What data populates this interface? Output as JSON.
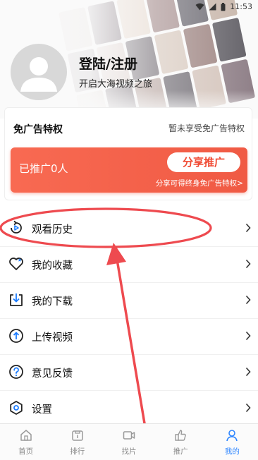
{
  "status_bar": {
    "time": "11:53"
  },
  "colors": {
    "accent": "#2f86ff",
    "promo": "#f05a44",
    "annotation": "#ee4a4f"
  },
  "profile": {
    "title": "登陆/注册",
    "subtitle": "开启大海视频之旅"
  },
  "vip": {
    "title": "免广告特权",
    "status": "暂未享受免广告特权",
    "promo_count": "已推广0人",
    "share_button": "分享推广",
    "share_note": "分享可得终身免广告特权>"
  },
  "menu": [
    {
      "label": "观看历史",
      "icon": "history-icon"
    },
    {
      "label": "我的收藏",
      "icon": "heart-icon"
    },
    {
      "label": "我的下载",
      "icon": "download-icon"
    },
    {
      "label": "上传视频",
      "icon": "upload-icon"
    },
    {
      "label": "意见反馈",
      "icon": "question-icon"
    },
    {
      "label": "设置",
      "icon": "settings-icon"
    }
  ],
  "bottom_nav": [
    {
      "label": "首页",
      "icon": "home-icon"
    },
    {
      "label": "排行",
      "icon": "ranking-icon"
    },
    {
      "label": "找片",
      "icon": "video-search-icon"
    },
    {
      "label": "推广",
      "icon": "promote-icon"
    },
    {
      "label": "我的",
      "icon": "profile-icon",
      "active": true
    }
  ]
}
